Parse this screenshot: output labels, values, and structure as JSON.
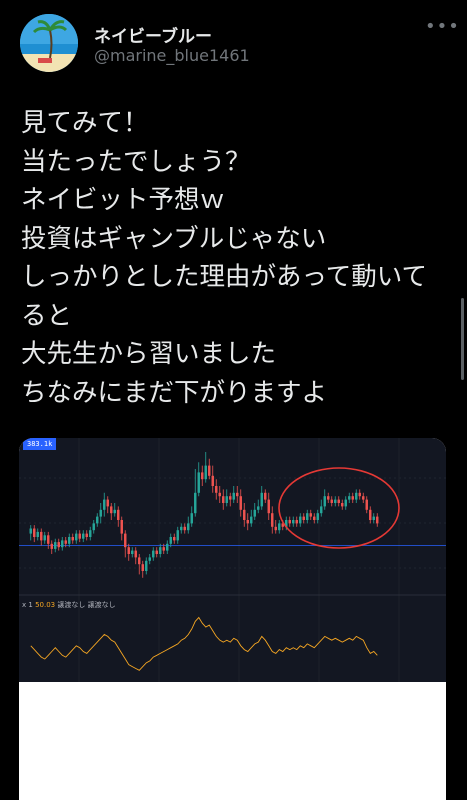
{
  "user": {
    "display_name": "ネイビーブルー",
    "handle": "@marine_blue1461",
    "avatar_icon": "beach-palm-avatar"
  },
  "header": {
    "more_icon": "more-dots-icon"
  },
  "tweet": {
    "lines": [
      "見てみて！",
      "当たったでしょう？",
      "ネイビット予想ｗ",
      "投資はギャンブルじゃない",
      "しっかりとした理由があって動いて",
      "ると",
      "大先生から習いました",
      "ちなみにまだ下がりますよ"
    ]
  },
  "media": {
    "price_badge": "383.1k",
    "rsi_legend": {
      "prefix": "x 1",
      "value": "50.03",
      "label_1": "譲渡なし",
      "label_2": "譲渡なし"
    },
    "colors": {
      "background": "#131722",
      "up": "#26a69a",
      "down": "#ef5350",
      "rsi_line": "#f5a623",
      "annotation": "#e53935",
      "price_line": "#2962ff"
    }
  },
  "chart_data": {
    "type": "candlestick",
    "candles": [
      [
        52,
        55,
        48,
        57
      ],
      [
        55,
        50,
        47,
        57
      ],
      [
        50,
        53,
        48,
        55
      ],
      [
        53,
        48,
        45,
        55
      ],
      [
        48,
        51,
        46,
        53
      ],
      [
        51,
        46,
        43,
        53
      ],
      [
        46,
        43,
        40,
        48
      ],
      [
        43,
        47,
        41,
        49
      ],
      [
        47,
        44,
        42,
        49
      ],
      [
        44,
        48,
        42,
        50
      ],
      [
        48,
        46,
        44,
        50
      ],
      [
        46,
        50,
        44,
        52
      ],
      [
        50,
        48,
        46,
        52
      ],
      [
        48,
        52,
        46,
        54
      ],
      [
        52,
        49,
        47,
        54
      ],
      [
        49,
        52,
        47,
        54
      ],
      [
        52,
        50,
        48,
        54
      ],
      [
        50,
        54,
        48,
        56
      ],
      [
        54,
        58,
        52,
        60
      ],
      [
        58,
        62,
        56,
        64
      ],
      [
        62,
        66,
        58,
        70
      ],
      [
        66,
        72,
        62,
        76
      ],
      [
        72,
        68,
        64,
        74
      ],
      [
        68,
        64,
        60,
        70
      ],
      [
        64,
        66,
        62,
        70
      ],
      [
        66,
        60,
        56,
        68
      ],
      [
        60,
        52,
        48,
        62
      ],
      [
        52,
        44,
        38,
        54
      ],
      [
        44,
        40,
        36,
        46
      ],
      [
        40,
        42,
        38,
        44
      ],
      [
        42,
        38,
        34,
        44
      ],
      [
        38,
        34,
        28,
        40
      ],
      [
        34,
        30,
        26,
        36
      ],
      [
        30,
        36,
        28,
        38
      ],
      [
        36,
        38,
        34,
        40
      ],
      [
        38,
        42,
        36,
        44
      ],
      [
        42,
        40,
        38,
        44
      ],
      [
        40,
        44,
        38,
        46
      ],
      [
        44,
        42,
        40,
        46
      ],
      [
        42,
        46,
        40,
        48
      ],
      [
        46,
        50,
        44,
        52
      ],
      [
        50,
        48,
        46,
        52
      ],
      [
        48,
        54,
        46,
        56
      ],
      [
        54,
        56,
        52,
        58
      ],
      [
        56,
        54,
        52,
        58
      ],
      [
        54,
        58,
        52,
        62
      ],
      [
        58,
        64,
        56,
        68
      ],
      [
        64,
        76,
        62,
        90
      ],
      [
        76,
        88,
        74,
        94
      ],
      [
        88,
        84,
        80,
        92
      ],
      [
        84,
        92,
        82,
        100
      ],
      [
        92,
        86,
        84,
        96
      ],
      [
        86,
        80,
        76,
        92
      ],
      [
        80,
        76,
        72,
        84
      ],
      [
        76,
        74,
        70,
        80
      ],
      [
        74,
        70,
        66,
        78
      ],
      [
        70,
        74,
        68,
        78
      ],
      [
        74,
        72,
        68,
        76
      ],
      [
        72,
        76,
        70,
        80
      ],
      [
        76,
        74,
        70,
        80
      ],
      [
        74,
        66,
        62,
        78
      ],
      [
        66,
        60,
        56,
        70
      ],
      [
        60,
        58,
        54,
        64
      ],
      [
        58,
        62,
        56,
        66
      ],
      [
        62,
        66,
        60,
        70
      ],
      [
        66,
        68,
        64,
        72
      ],
      [
        68,
        76,
        66,
        80
      ],
      [
        76,
        72,
        70,
        78
      ],
      [
        72,
        64,
        60,
        76
      ],
      [
        64,
        56,
        52,
        68
      ],
      [
        56,
        54,
        52,
        60
      ],
      [
        54,
        58,
        52,
        60
      ],
      [
        58,
        56,
        54,
        60
      ],
      [
        56,
        60,
        54,
        62
      ],
      [
        60,
        58,
        56,
        62
      ],
      [
        58,
        60,
        56,
        62
      ],
      [
        60,
        58,
        56,
        62
      ],
      [
        58,
        62,
        56,
        64
      ],
      [
        62,
        60,
        58,
        64
      ],
      [
        60,
        64,
        58,
        66
      ],
      [
        64,
        62,
        60,
        66
      ],
      [
        62,
        60,
        58,
        64
      ],
      [
        60,
        64,
        58,
        66
      ],
      [
        64,
        68,
        62,
        72
      ],
      [
        68,
        74,
        66,
        78
      ],
      [
        74,
        72,
        70,
        76
      ],
      [
        72,
        70,
        68,
        74
      ],
      [
        70,
        72,
        68,
        74
      ],
      [
        72,
        70,
        68,
        74
      ],
      [
        70,
        68,
        66,
        72
      ],
      [
        68,
        72,
        66,
        74
      ],
      [
        72,
        74,
        70,
        76
      ],
      [
        74,
        72,
        70,
        76
      ],
      [
        72,
        76,
        70,
        78
      ],
      [
        76,
        74,
        72,
        78
      ],
      [
        74,
        72,
        70,
        76
      ],
      [
        72,
        66,
        64,
        74
      ],
      [
        66,
        60,
        58,
        68
      ],
      [
        60,
        62,
        58,
        64
      ],
      [
        62,
        58,
        56,
        64
      ]
    ],
    "rsi": [
      52,
      48,
      44,
      40,
      38,
      42,
      46,
      50,
      46,
      42,
      40,
      44,
      48,
      52,
      50,
      46,
      44,
      48,
      52,
      56,
      60,
      64,
      62,
      58,
      56,
      50,
      44,
      38,
      32,
      30,
      28,
      26,
      30,
      34,
      36,
      40,
      42,
      44,
      46,
      48,
      50,
      52,
      54,
      58,
      60,
      64,
      70,
      78,
      82,
      76,
      72,
      74,
      68,
      62,
      58,
      56,
      58,
      56,
      60,
      58,
      52,
      48,
      46,
      50,
      54,
      56,
      62,
      58,
      52,
      46,
      44,
      48,
      46,
      50,
      48,
      50,
      48,
      52,
      50,
      54,
      52,
      50,
      54,
      58,
      62,
      60,
      58,
      60,
      58,
      56,
      58,
      60,
      58,
      62,
      60,
      58,
      50,
      44,
      46,
      42
    ],
    "price_line": 45,
    "ylim": [
      20,
      100
    ],
    "rsi_ylim": [
      20,
      90
    ]
  }
}
